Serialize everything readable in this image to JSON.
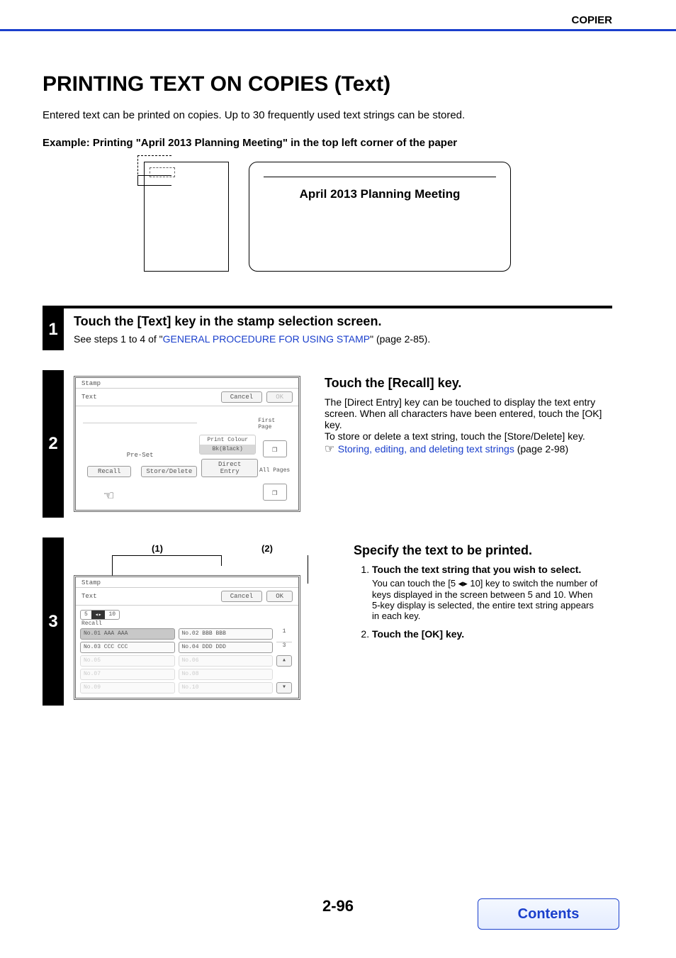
{
  "header": {
    "section": "COPIER"
  },
  "page": {
    "title": "PRINTING TEXT ON COPIES (Text)",
    "intro": "Entered text can be printed on copies. Up to 30 frequently used text strings can be stored.",
    "example_label": "Example: Printing \"April 2013 Planning Meeting\" in the top left corner of the paper",
    "illustration_text": "April 2013 Planning Meeting"
  },
  "step1": {
    "number": "1",
    "title": "Touch the [Text] key in the stamp selection screen.",
    "text_pre": "See steps 1 to 4 of \"",
    "link": "GENERAL PROCEDURE FOR USING STAMP",
    "text_post": "\" (page 2-85)."
  },
  "step2": {
    "number": "2",
    "screen": {
      "tab": "Stamp",
      "subtab": "Text",
      "cancel": "Cancel",
      "ok": "OK",
      "preset": "Pre-Set",
      "recall": "Recall",
      "store_delete": "Store/Delete",
      "print_colour_hdr": "Print Colour",
      "print_colour_val": "Bk(Black)",
      "direct_entry": "Direct Entry",
      "first_page": "First Page",
      "all_pages": "All Pages"
    },
    "right": {
      "title": "Touch the [Recall] key.",
      "p1": "The [Direct Entry] key can be touched to display the text entry screen. When all characters have been entered, touch the [OK] key.",
      "p2": "To store or delete a text string, touch the [Store/Delete] key.",
      "link": "Storing, editing, and deleting text strings",
      "link_post": " (page 2-98)"
    }
  },
  "step3": {
    "number": "3",
    "callouts": {
      "c1": "(1)",
      "c2": "(2)"
    },
    "screen": {
      "tab": "Stamp",
      "subtab": "Text",
      "cancel": "Cancel",
      "ok": "OK",
      "toggle_5": "5",
      "toggle_10": "10",
      "recall_lbl": "Recall",
      "items": [
        "No.01 AAA AAA",
        "No.02 BBB BBB",
        "No.03 CCC CCC",
        "No.04 DDD DDD",
        "No.05",
        "No.06",
        "No.07",
        "No.08",
        "No.09",
        "No.10"
      ],
      "count_top": "1",
      "count_bot": "3"
    },
    "right": {
      "title": "Specify the text to be printed.",
      "li1_title": "Touch the text string that you wish to select.",
      "li1_desc": "You can touch the [5 ◂▸ 10] key to switch the number of keys displayed in the screen between 5 and 10. When 5-key display is selected, the entire text string appears in each key.",
      "li2_title": "Touch the [OK] key."
    }
  },
  "footer": {
    "page_number": "2-96",
    "contents": "Contents"
  }
}
